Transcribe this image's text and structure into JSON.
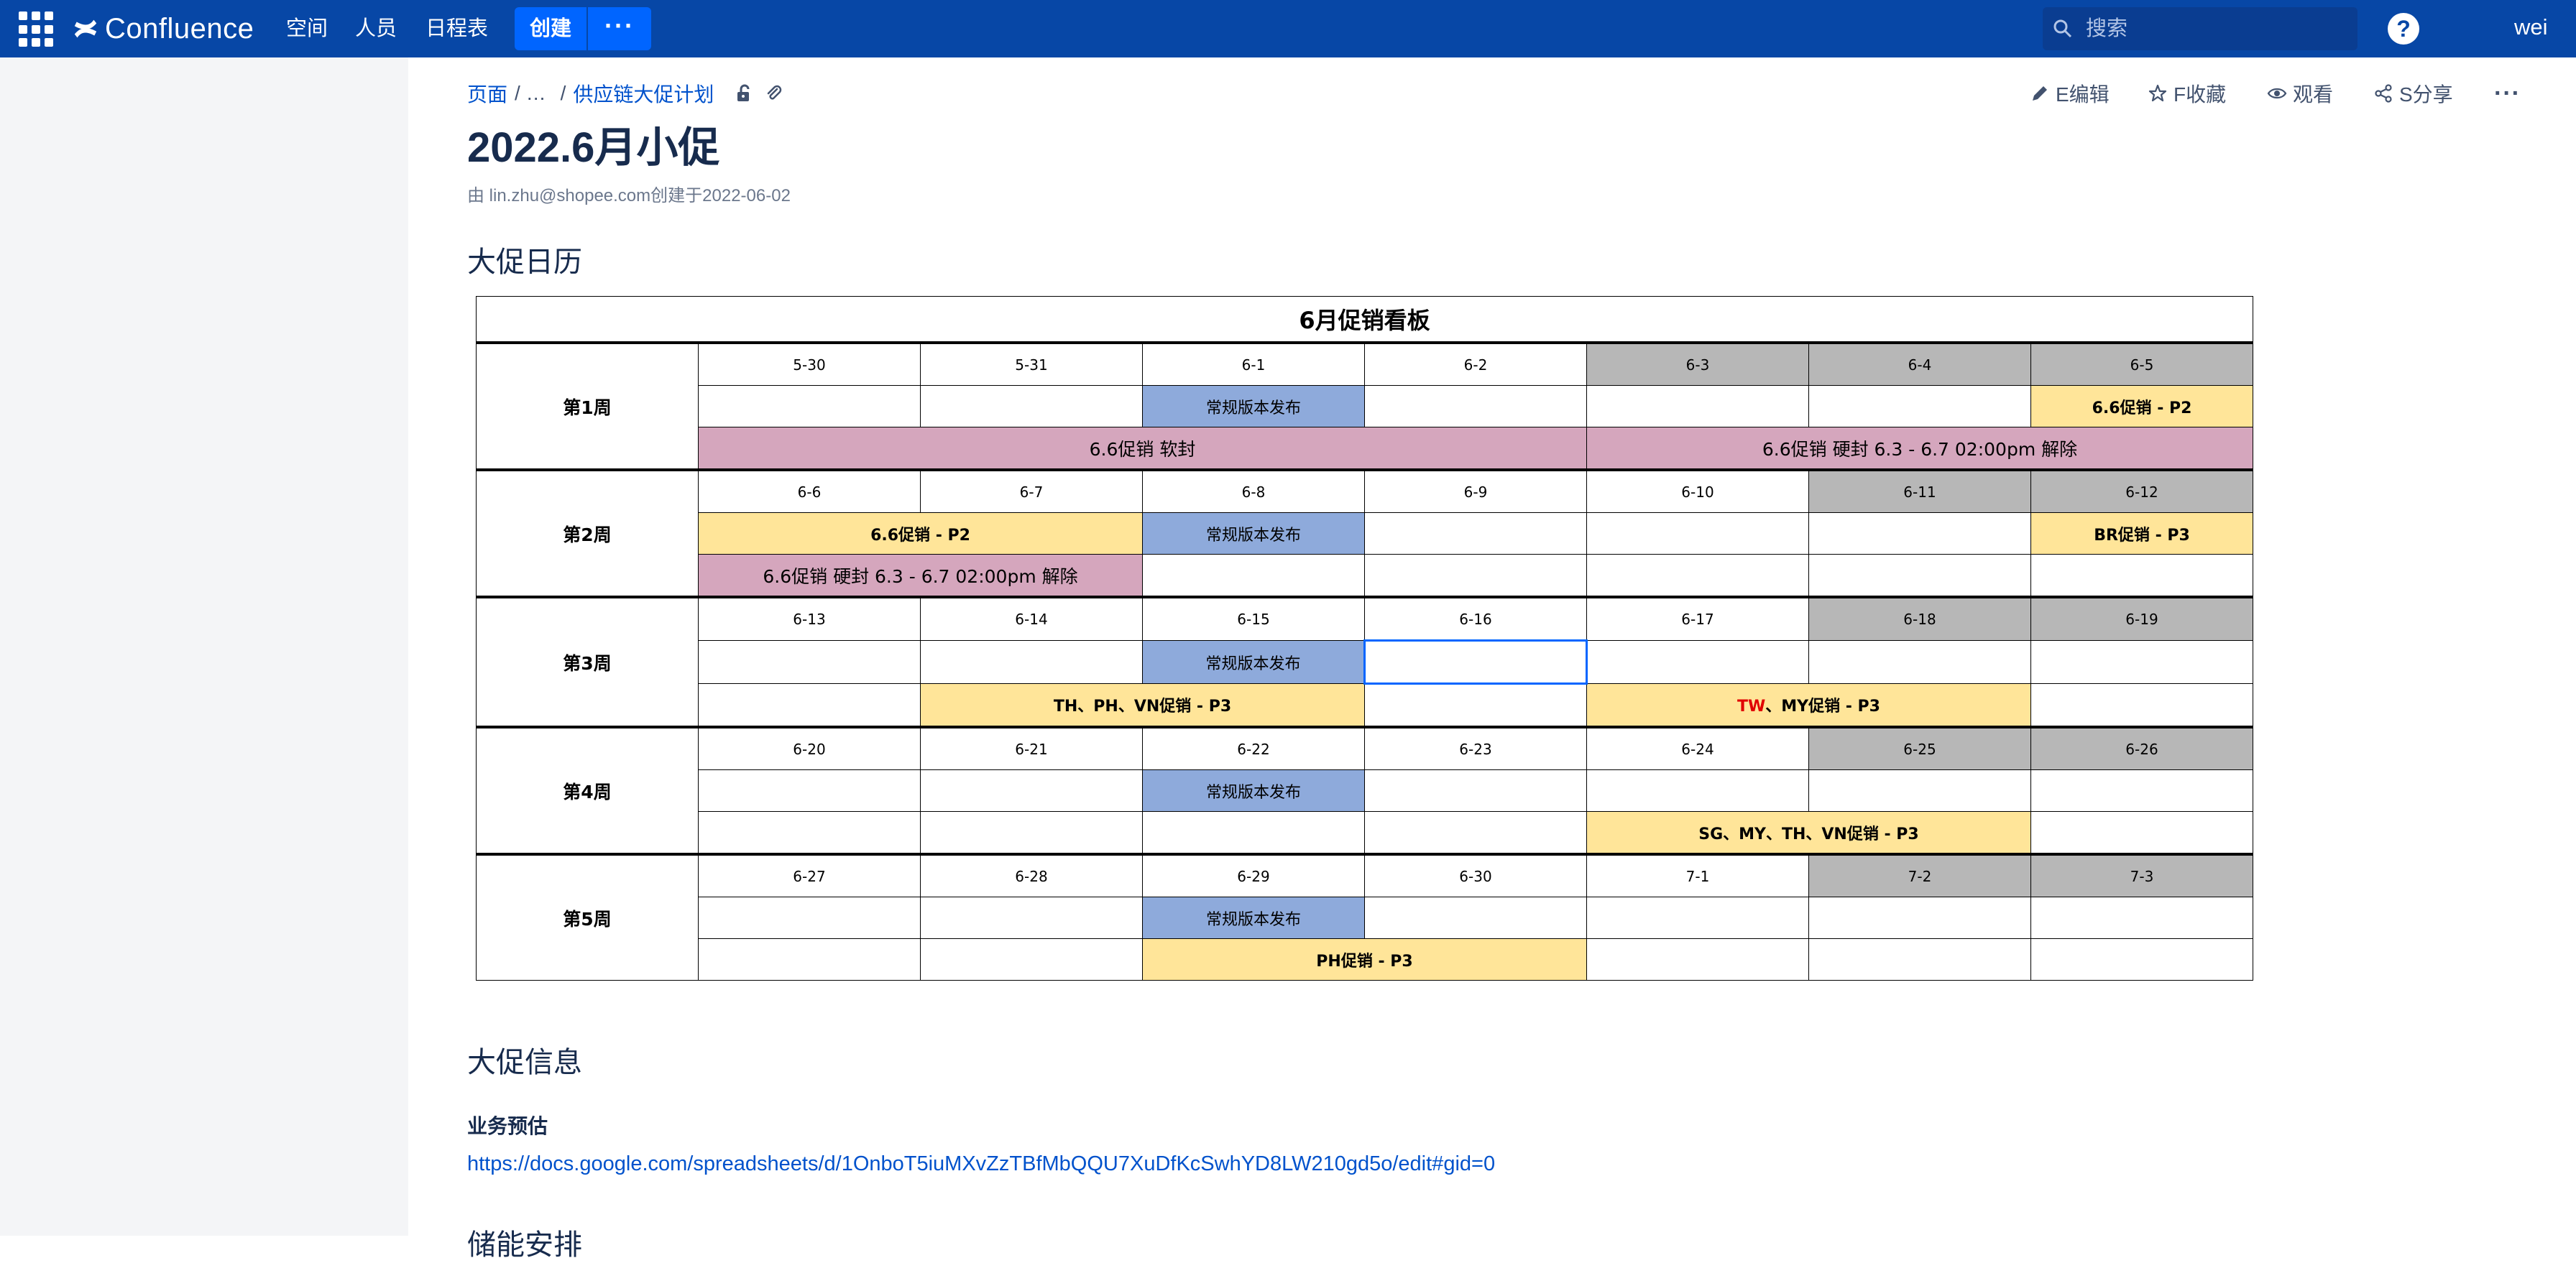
{
  "nav": {
    "logo": "Confluence",
    "links": [
      "空间",
      "人员",
      "日程表"
    ],
    "create": "创建",
    "more": "···",
    "search_placeholder": "搜索",
    "help": "?",
    "user": "wei"
  },
  "breadcrumb": {
    "root": "页面",
    "ellipsis": "/ …",
    "sep": "/",
    "parent": "供应链大促计划"
  },
  "actions": {
    "edit": "E编辑",
    "favorite": "F收藏",
    "watch": "观看",
    "share": "S分享",
    "more": "···"
  },
  "page": {
    "title": "2022.6月小促",
    "byline": "由 lin.zhu@shopee.com创建于2022-06-02"
  },
  "sections": {
    "calendar": "大促日历",
    "info": "大促信息",
    "forecast": "业务预估",
    "forecast_link": "https://docs.google.com/spreadsheets/d/1OnboT5iuMXvZzTBfMbQQU7XuDfKcSwhYD8LW210gd5o/edit#gid=0",
    "next_partial": "储能安排"
  },
  "calendar": {
    "title": "6月促销看板",
    "release": "常规版本发布",
    "weeks": [
      {
        "label": "第1周",
        "dates": [
          "5-30",
          "5-31",
          "6-1",
          "6-2",
          "6-3",
          "6-4",
          "6-5"
        ],
        "p2": "6.6促销 - P2",
        "soft": "6.6促销 软封",
        "hard": "6.6促销 硬封 6.3 - 6.7 02:00pm 解除"
      },
      {
        "label": "第2周",
        "dates": [
          "6-6",
          "6-7",
          "6-8",
          "6-9",
          "6-10",
          "6-11",
          "6-12"
        ],
        "p2": "6.6促销 - P2",
        "br": "BR促销 - P3",
        "hard": "6.6促销 硬封 6.3 - 6.7 02:00pm 解除"
      },
      {
        "label": "第3周",
        "dates": [
          "6-13",
          "6-14",
          "6-15",
          "6-16",
          "6-17",
          "6-18",
          "6-19"
        ],
        "promo1": "TH、PH、VN促销 - P3",
        "promo2_red": "TW",
        "promo2_rest": "、MY促销 - P3"
      },
      {
        "label": "第4周",
        "dates": [
          "6-20",
          "6-21",
          "6-22",
          "6-23",
          "6-24",
          "6-25",
          "6-26"
        ],
        "promo": "SG、MY、TH、VN促销 - P3"
      },
      {
        "label": "第5周",
        "dates": [
          "6-27",
          "6-28",
          "6-29",
          "6-30",
          "7-1",
          "7-2",
          "7-3"
        ],
        "promo": "PH促销 - P3"
      }
    ]
  },
  "colors": {
    "nav": "#0747a6",
    "create": "#0065ff",
    "release": "#8eaadb",
    "promo": "#ffe599",
    "freeze": "#d5a6bd",
    "weekend": "#b7b7b7",
    "link": "#0052cc"
  }
}
